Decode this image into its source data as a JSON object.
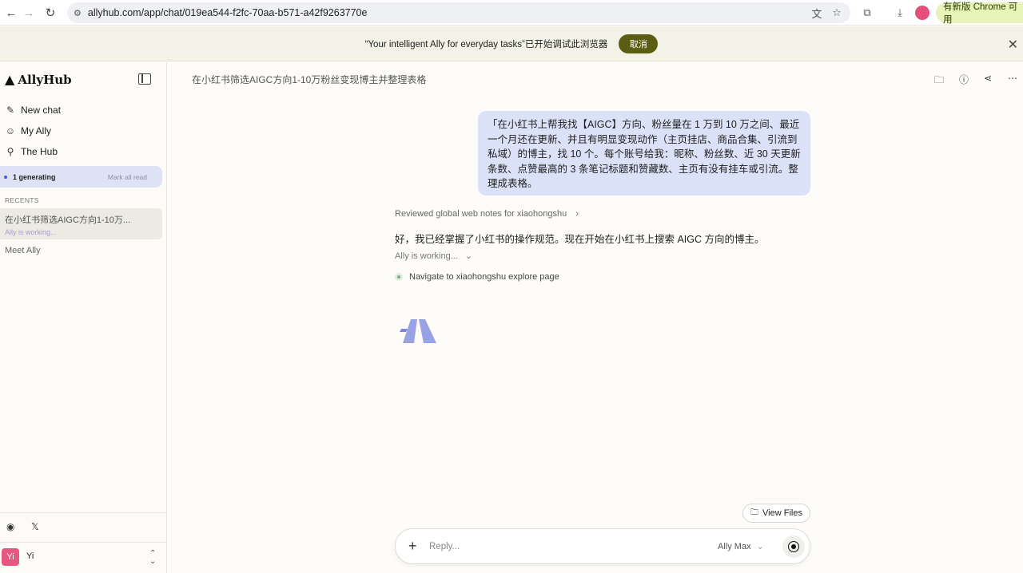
{
  "browser": {
    "url": "allyhub.com/app/chat/019ea544-f2fc-70aa-b571-a42f9263770e",
    "update_label": "有新版 Chrome 可用"
  },
  "debug_banner": {
    "text": "“Your intelligent Ally for everyday tasks”已开始调试此浏览器",
    "cancel_label": "取消"
  },
  "sidebar": {
    "logo": "AllyHub",
    "nav": [
      {
        "label": "New chat",
        "icon": "edit-icon"
      },
      {
        "label": "My Ally",
        "icon": "ally-icon"
      },
      {
        "label": "The Hub",
        "icon": "hub-icon"
      }
    ],
    "generating": {
      "label": "1 generating",
      "mark_read": "Mark all read"
    },
    "recents_label": "RECENTS",
    "recents": [
      {
        "title": "在小红书筛选AIGC方向1-10万...",
        "status": "Ally is working..."
      }
    ],
    "meet_ally": "Meet Ally",
    "user": {
      "initials": "Yi",
      "name": "Yi"
    }
  },
  "main": {
    "title": "在小红书筛选AIGC方向1-10万粉丝变现博主并整理表格",
    "user_message": "「在小红书上帮我找【AIGC】方向、粉丝量在 1 万到 10 万之间、最近一个月还在更新、并且有明显变现动作（主页挂店、商品合集、引流到私域）的博主，找 10 个。每个账号给我：昵称、粉丝数、近 30 天更新条数、点赞最高的 3 条笔记标题和赞藏数、主页有没有挂车或引流。整理成表格。",
    "reviewed": "Reviewed global web notes for xiaohongshu",
    "reply": "好，我已经掌握了小红书的操作规范。现在开始在小红书上搜索 AIGC 方向的博主。",
    "working": "Ally is working...",
    "step": "Navigate to xiaohongshu explore page",
    "view_files": "View Files",
    "composer": {
      "placeholder": "Reply...",
      "model": "Ally Max"
    }
  },
  "colors": {
    "accent": "#5c5d15",
    "user_bubble": "#dbe1f7",
    "generating_bg": "#dde2f4",
    "avatar": "#e8577f"
  }
}
